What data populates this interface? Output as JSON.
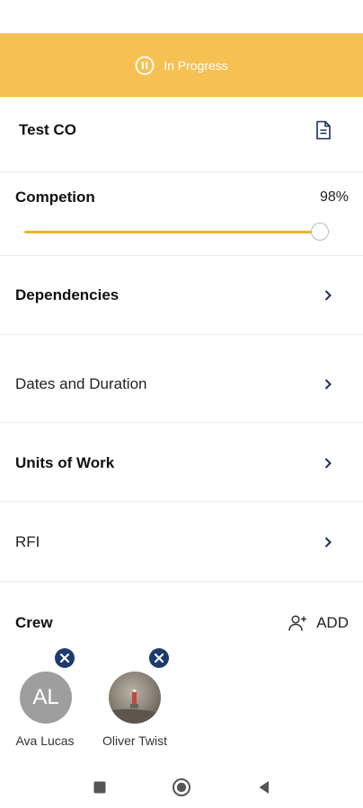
{
  "status": {
    "label": "In Progress",
    "icon": "pause-circle-icon",
    "color": "#F6C152"
  },
  "header": {
    "title": "Test CO",
    "doc_icon": "document-icon"
  },
  "completion": {
    "label": "Competion",
    "value_text": "98%",
    "value": 0.98,
    "accent": "#F2B32A"
  },
  "sections": [
    {
      "label": "Dependencies",
      "bold": true
    },
    {
      "label": "Dates and Duration",
      "bold": false
    },
    {
      "label": "Units of Work",
      "bold": true
    },
    {
      "label": "RFI",
      "bold": false
    }
  ],
  "crew": {
    "title": "Crew",
    "add_label": "ADD",
    "members": [
      {
        "name": "Ava Lucas",
        "initials": "AL"
      },
      {
        "name": "Oliver Twist",
        "initials": ""
      }
    ]
  },
  "system_nav": {
    "buttons": [
      "recents-square-icon",
      "home-circle-icon",
      "back-triangle-icon"
    ]
  }
}
